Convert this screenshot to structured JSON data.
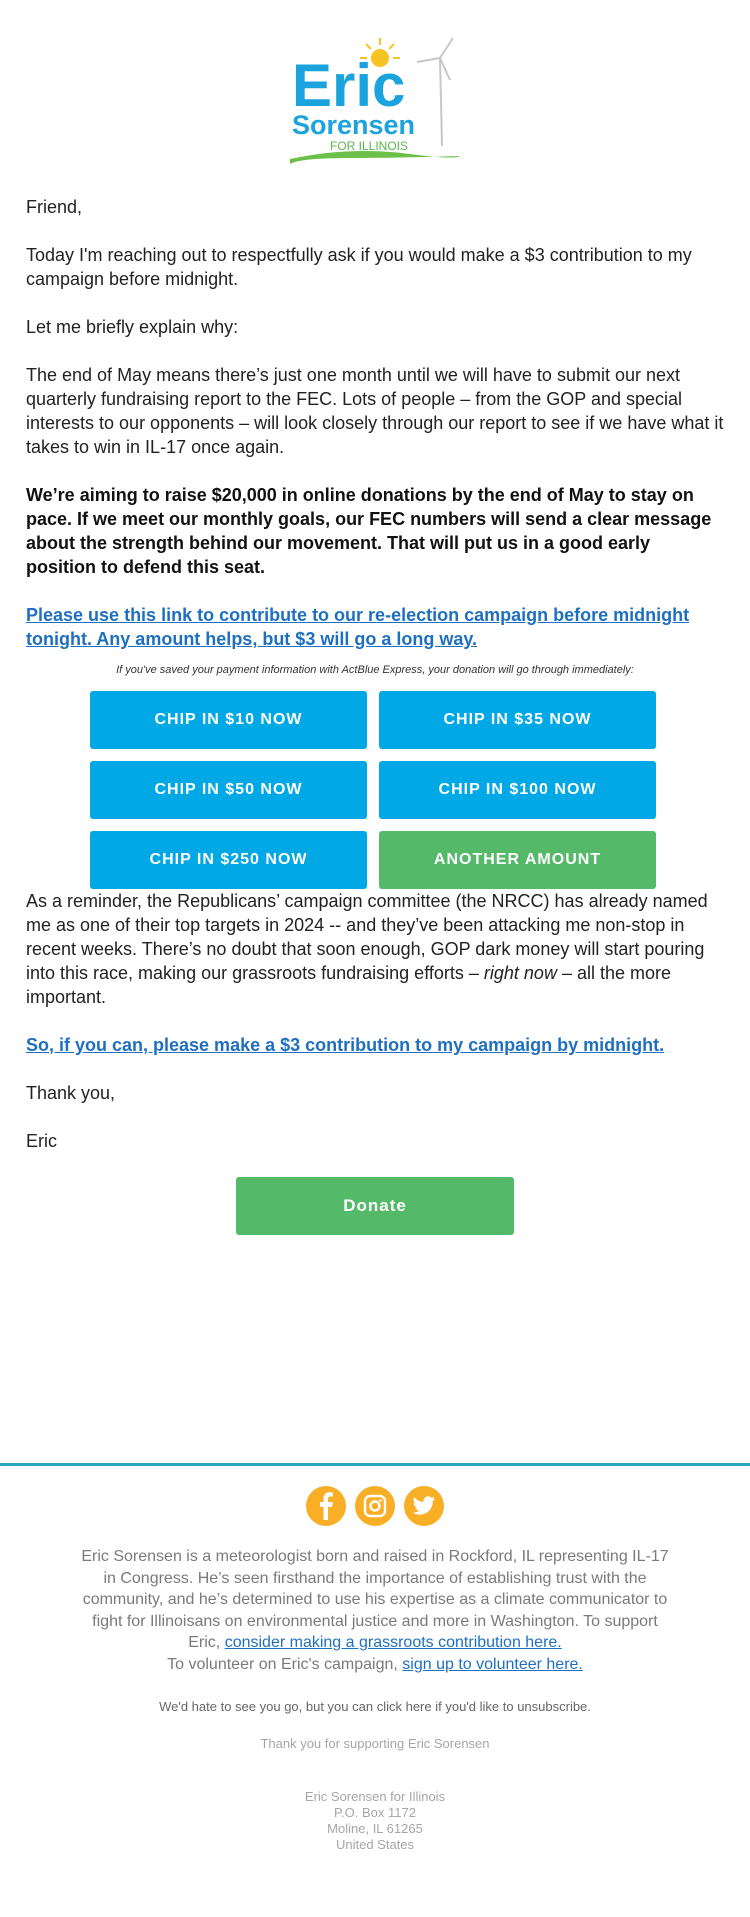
{
  "logo": {
    "line1": "Eric",
    "line2": "Sorensen",
    "line3": "FOR ILLINOIS"
  },
  "body": {
    "greeting": "Friend,",
    "p1": "Today I'm reaching out to respectfully ask if you would make a $3 contribution to my campaign before midnight.",
    "p2": "Let me briefly explain why:",
    "p3": "The end of May means there’s just one month until we will have to submit our next quarterly fundraising report to the FEC. Lots of people – from the GOP and special interests to our opponents – will look closely through our report to see if we have what it takes to win in IL-17 once again.",
    "p4": "We’re aiming to raise $20,000 in online donations by the end of May to stay on pace. If we meet our monthly goals, our FEC numbers will send a clear message about the strength behind our movement. That will put us in a good early position to defend this seat.",
    "link1": "Please use this link to contribute to our re-election campaign before midnight tonight. Any amount helps, but $3 will go a long way.",
    "express_note": "If you've saved your payment information with ActBlue Express, your donation will go through immediately:",
    "p5_a": "As a reminder, the Republicans’ campaign committee (the NRCC) has already named me as one of their top targets in 2024 -- and they’ve been attacking me non-stop in recent weeks. There’s no doubt that soon enough, GOP dark money will start pouring into this race, making our grassroots fundraising efforts – ",
    "p5_em": "right now",
    "p5_b": " – all the more important.",
    "link2": "So, if you can, please make a $3 contribution to my campaign by midnight.",
    "signoff": "Thank you,",
    "signature": "Eric"
  },
  "buttons": [
    {
      "label": "CHIP IN $10 NOW",
      "color": "#00a8e6"
    },
    {
      "label": "CHIP IN $35 NOW",
      "color": "#00a8e6"
    },
    {
      "label": "CHIP IN $50 NOW",
      "color": "#00a8e6"
    },
    {
      "label": "CHIP IN $100 NOW",
      "color": "#00a8e6"
    },
    {
      "label": "CHIP IN $250 NOW",
      "color": "#00a8e6"
    },
    {
      "label": "ANOTHER AMOUNT",
      "color": "#55b96a"
    }
  ],
  "donate_label": "Donate",
  "footer": {
    "social": [
      "facebook-icon",
      "instagram-icon",
      "twitter-icon"
    ],
    "bio": "Eric Sorensen is a meteorologist born and raised in Rockford, IL representing IL-17 in Congress. He’s seen firsthand the importance of establishing trust with the community, and he’s determined to use his expertise as a climate communicator to fight for Illinoisans on environmental justice and more in Washington. To support Eric, ",
    "contribute_link": "consider making a grassroots contribution here.",
    "volunteer_text": "To volunteer on Eric's campaign, ",
    "volunteer_link": "sign up to volunteer here.",
    "unsubscribe": "We'd hate to see you go, but you can click here if you'd like to unsubscribe.",
    "thanks": "Thank you for supporting Eric Sorensen",
    "address": [
      "Eric Sorensen for Illinois",
      "P.O. Box 1172",
      "Moline, IL 61265",
      "United States"
    ]
  },
  "colors": {
    "brand_blue": "#00a8e6",
    "brand_green": "#55b96a",
    "social_orange": "#f8ae25",
    "divider": "#2aa7c0",
    "link": "#1f6fc0"
  }
}
